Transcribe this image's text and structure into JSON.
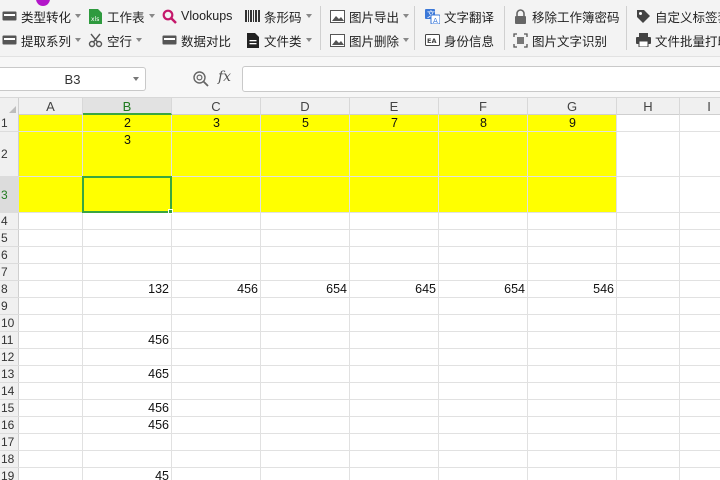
{
  "toolbar": {
    "row1": [
      {
        "label": "类型转化",
        "icon": "convert-icon",
        "dropdown": true
      },
      {
        "label": "工作表",
        "icon": "worksheet-icon",
        "dropdown": true
      },
      {
        "label": "Vlookups",
        "icon": "search-icon",
        "dropdown": false
      },
      {
        "label": "条形码",
        "icon": "barcode-icon",
        "dropdown": true
      },
      {
        "label": "图片导出",
        "icon": "image-export-icon",
        "dropdown": true
      },
      {
        "label": "文字翻译",
        "icon": "translate-icon",
        "dropdown": false
      },
      {
        "label": "移除工作簿密码",
        "icon": "lock-icon",
        "dropdown": false
      },
      {
        "label": "自定义标签套打",
        "icon": "tag-icon",
        "dropdown": false
      }
    ],
    "row2": [
      {
        "label": "提取系列",
        "icon": "extract-icon",
        "dropdown": true
      },
      {
        "label": "空行",
        "icon": "scissors-icon",
        "dropdown": true
      },
      {
        "label": "数据对比",
        "icon": "compare-icon",
        "dropdown": false
      },
      {
        "label": "文件类",
        "icon": "file-icon",
        "dropdown": true
      },
      {
        "label": "图片删除",
        "icon": "image-delete-icon",
        "dropdown": true
      },
      {
        "label": "身份信息",
        "icon": "id-card-icon",
        "dropdown": false
      },
      {
        "label": "图片文字识别",
        "icon": "ocr-icon",
        "dropdown": false
      },
      {
        "label": "文件批量打印",
        "icon": "print-icon",
        "dropdown": false
      }
    ]
  },
  "formula_bar": {
    "name_box": "B3",
    "fx_label": "fx",
    "formula_value": ""
  },
  "columns": [
    "A",
    "B",
    "C",
    "D",
    "E",
    "F",
    "G",
    "H",
    "I"
  ],
  "rows": [
    "1",
    "2",
    "3",
    "4",
    "5",
    "6",
    "7",
    "8",
    "9",
    "10",
    "11",
    "12",
    "13",
    "14",
    "15",
    "16",
    "17",
    "18",
    "19"
  ],
  "selected_cell": {
    "column": "B",
    "row": "3"
  },
  "highlight_color": "#FFFF00",
  "selection_color": "#3AA640",
  "cells": {
    "B1": "2",
    "C1": "3",
    "D1": "5",
    "E1": "7",
    "F1": "8",
    "G1": "9",
    "B2": "3",
    "B8": "132",
    "C8": "456",
    "D8": "654",
    "E8": "645",
    "F8": "654",
    "G8": "546",
    "B11": "456",
    "B13": "465",
    "B15": "456",
    "B16": "456",
    "B19": "45"
  }
}
